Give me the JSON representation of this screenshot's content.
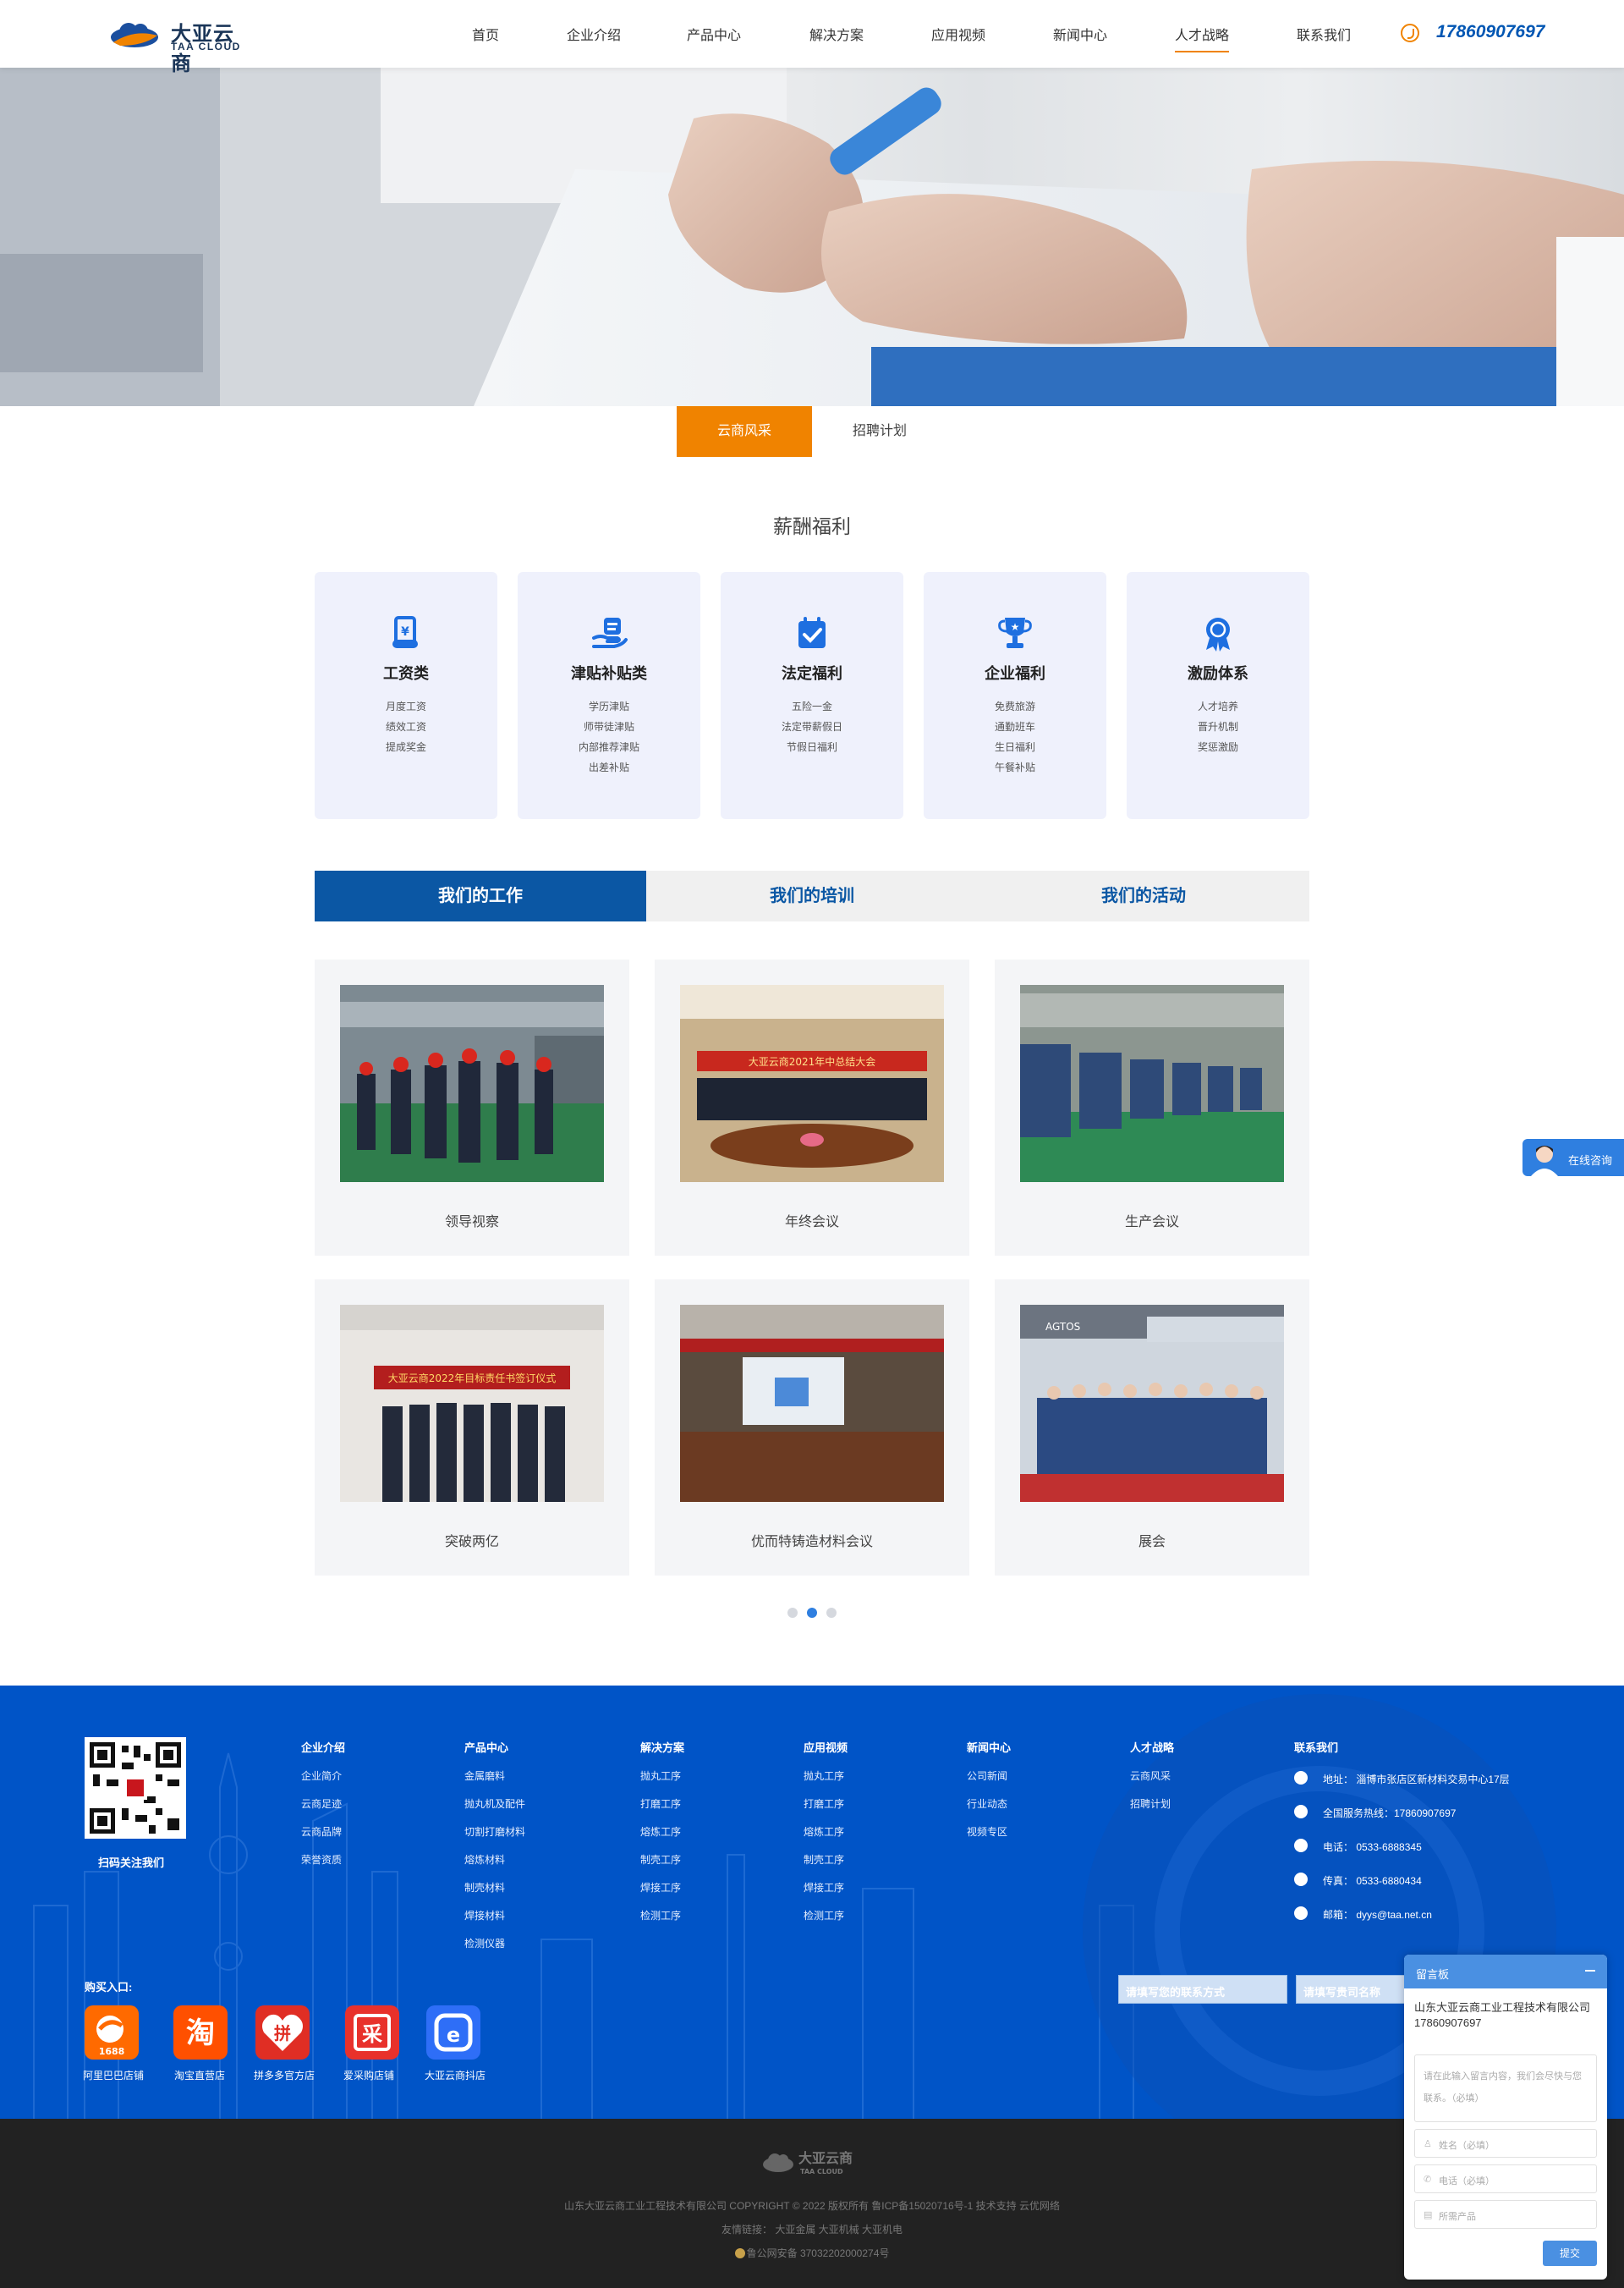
{
  "header": {
    "logo_cn": "大亚云商",
    "logo_en": "TAA CLOUD",
    "nav": [
      "首页",
      "企业介绍",
      "产品中心",
      "解决方案",
      "应用视频",
      "新闻中心",
      "人才战略",
      "联系我们"
    ],
    "active_nav": "人才战略",
    "phone": "17860907697"
  },
  "subtabs": [
    {
      "label": "云商风采",
      "active": true
    },
    {
      "label": "招聘计划",
      "active": false
    }
  ],
  "salary": {
    "title": "薪酬福利",
    "cards": [
      {
        "title": "工资类",
        "icon": "salary-scroll-icon",
        "items": [
          "月度工资",
          "绩效工资",
          "提成奖金"
        ]
      },
      {
        "title": "津贴补贴类",
        "icon": "allowance-hand-icon",
        "items": [
          "学历津贴",
          "师带徒津贴",
          "内部推荐津贴",
          "出差补贴"
        ]
      },
      {
        "title": "法定福利",
        "icon": "calendar-check-icon",
        "items": [
          "五险一金",
          "法定带薪假日",
          "节假日福利"
        ]
      },
      {
        "title": "企业福利",
        "icon": "trophy-icon",
        "items": [
          "免费旅游",
          "通勤班车",
          "生日福利",
          "午餐补贴"
        ]
      },
      {
        "title": "激励体系",
        "icon": "medal-icon",
        "items": [
          "人才培养",
          "晋升机制",
          "奖惩激励"
        ]
      }
    ]
  },
  "activity_tabs": [
    {
      "label": "我们的工作",
      "active": true
    },
    {
      "label": "我们的培训",
      "active": false
    },
    {
      "label": "我们的活动",
      "active": false
    }
  ],
  "photos": [
    {
      "caption": "领导视察"
    },
    {
      "caption": "年终会议"
    },
    {
      "caption": "生产会议"
    },
    {
      "caption": "突破两亿"
    },
    {
      "caption": "优而特铸造材料会议"
    },
    {
      "caption": "展会"
    }
  ],
  "photo_texts": {
    "banner_2021": "大亚云商2021年中总结大会",
    "banner_2022": "大亚云商2022年目标责任书签订仪式",
    "sign_expo": "AGTOS"
  },
  "pagination": {
    "total": 3,
    "current": 2
  },
  "footer": {
    "qr_label": "扫码关注我们",
    "buy_label": "购买入口:",
    "columns": [
      {
        "title": "企业介绍",
        "links": [
          "企业简介",
          "云商足迹",
          "云商品牌",
          "荣誉资质"
        ]
      },
      {
        "title": "产品中心",
        "links": [
          "金属磨料",
          "抛丸机及配件",
          "切割打磨材料",
          "熔炼材料",
          "制壳材料",
          "焊接材料",
          "检测仪器"
        ]
      },
      {
        "title": "解决方案",
        "links": [
          "抛丸工序",
          "打磨工序",
          "熔炼工序",
          "制壳工序",
          "焊接工序",
          "检测工序"
        ]
      },
      {
        "title": "应用视频",
        "links": [
          "抛丸工序",
          "打磨工序",
          "熔炼工序",
          "制壳工序",
          "焊接工序",
          "检测工序"
        ]
      },
      {
        "title": "新闻中心",
        "links": [
          "公司新闻",
          "行业动态",
          "视频专区"
        ]
      },
      {
        "title": "人才战略",
        "links": [
          "云商风采",
          "招聘计划"
        ]
      }
    ],
    "contact": {
      "title": "联系我们",
      "items": [
        {
          "icon": "location-icon",
          "text": "地址： 淄博市张店区新材料交易中心17层"
        },
        {
          "icon": "phone-icon",
          "text": "全国服务热线：17860907697"
        },
        {
          "icon": "telephone-icon",
          "text": "电话： 0533-6888345"
        },
        {
          "icon": "fax-icon",
          "text": "传真： 0533-6880434"
        },
        {
          "icon": "mail-icon",
          "text": "邮箱： dyys@taa.net.cn"
        }
      ]
    },
    "shops": [
      {
        "label": "阿里巴巴店铺",
        "icon": "alibaba-1688-icon",
        "color": "#ff6a00",
        "glyph": "1688"
      },
      {
        "label": "淘宝直营店",
        "icon": "taobao-icon",
        "color": "#ff5000",
        "glyph": "淘"
      },
      {
        "label": "拼多多官方店",
        "icon": "pinduoduo-icon",
        "color": "#e02e24",
        "glyph": "拼"
      },
      {
        "label": "爱采购店铺",
        "icon": "aicaigou-icon",
        "color": "#e8312b",
        "glyph": "采"
      },
      {
        "label": "大亚云商抖店",
        "icon": "douyin-shop-icon",
        "color": "#2e6ef7",
        "glyph": "e"
      }
    ],
    "form": {
      "contact_placeholder": "请填写您的联系方式",
      "company_placeholder": "请填写贵司名称"
    }
  },
  "bottom": {
    "logo_cn": "大亚云商",
    "logo_en": "TAA CLOUD",
    "copyright": "山东大亚云商工业工程技术有限公司 COPYRIGHT © 2022 版权所有 鲁ICP备15020716号-1 技术支持 云优网络",
    "friends": "友情链接： 大亚金属 大亚机械 大亚机电",
    "police": "鲁公网安备 37032202000274号"
  },
  "consult": {
    "label": "在线咨询"
  },
  "message_board": {
    "title": "留言板",
    "company": "山东大亚云商工业工程技术有限公司17860907697",
    "content_placeholder": "请在此输入留言内容，我们会尽快与您联系。（必填）",
    "name_placeholder": "姓名（必填）",
    "phone_placeholder": "电话（必填）",
    "product_placeholder": "所需产品",
    "submit": "提交"
  },
  "colors": {
    "accent": "#f08300",
    "brand_blue": "#0b57a4",
    "footer_blue": "#0054c7",
    "card_bg": "#eff1fc",
    "icon_blue": "#1e6fe0"
  }
}
